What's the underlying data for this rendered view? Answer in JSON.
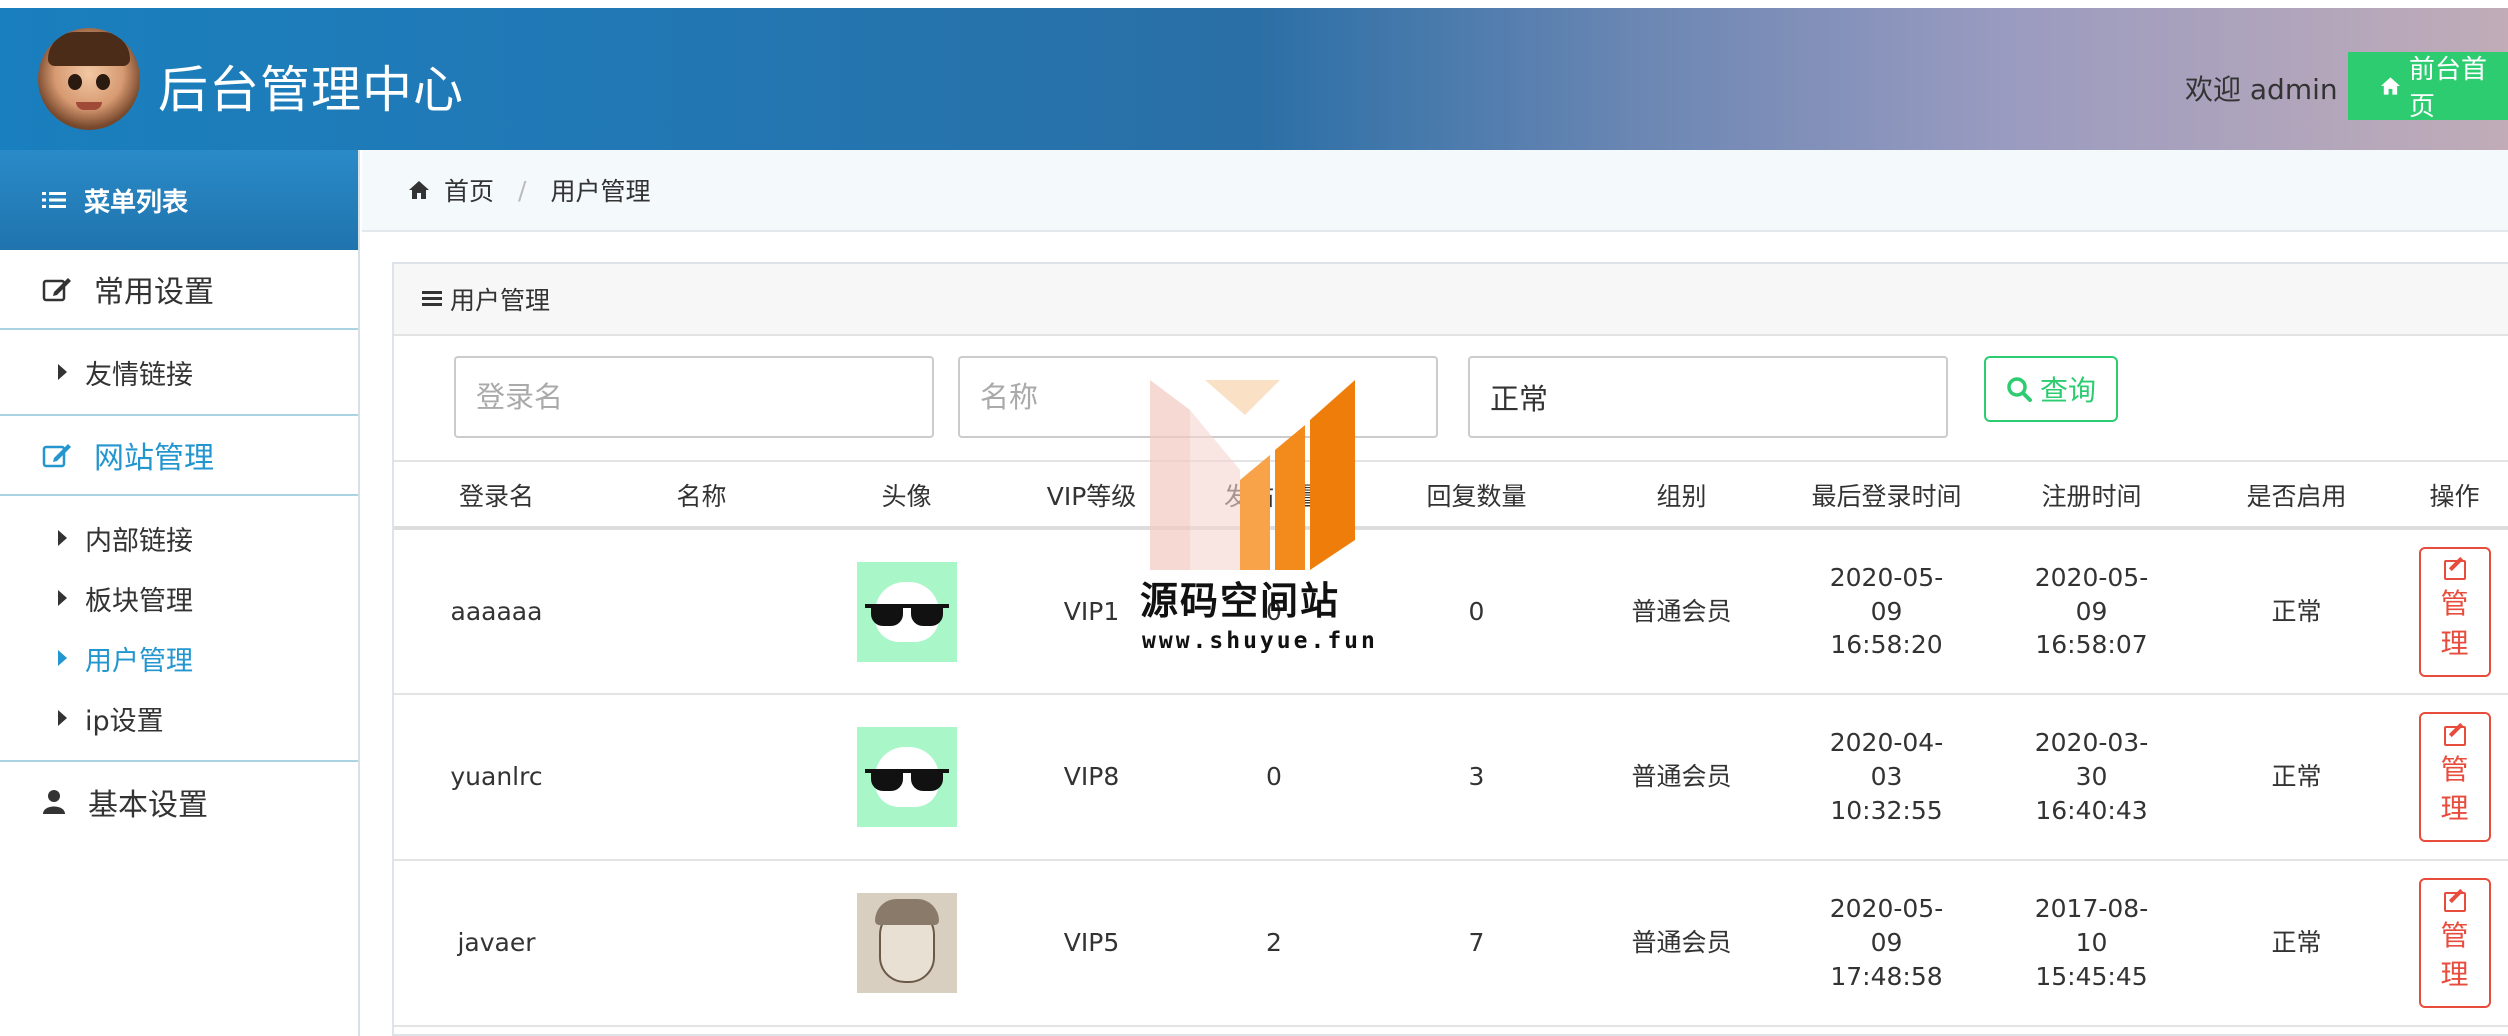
{
  "header": {
    "title": "后台管理中心",
    "welcome": "欢迎 admin",
    "front_button": "前台首页"
  },
  "sidebar": {
    "menu_title": "菜单列表",
    "groups": [
      {
        "label": "常用设置",
        "icon": "edit-icon",
        "items": [
          {
            "label": "友情链接"
          }
        ]
      },
      {
        "label": "网站管理",
        "icon": "edit-icon",
        "items": [
          {
            "label": "内部链接"
          },
          {
            "label": "板块管理"
          },
          {
            "label": "用户管理"
          },
          {
            "label": "ip设置"
          }
        ]
      },
      {
        "label": "基本设置",
        "icon": "user-icon",
        "items": []
      }
    ]
  },
  "breadcrumb": {
    "home": "首页",
    "current": "用户管理"
  },
  "panel": {
    "title": "用户管理"
  },
  "search": {
    "login_placeholder": "登录名",
    "name_placeholder": "名称",
    "status_value": "正常",
    "query_button": "查询"
  },
  "table": {
    "headers": [
      "登录名",
      "名称",
      "头像",
      "VIP等级",
      "发帖数量",
      "回复数量",
      "组别",
      "最后登录时间",
      "注册时间",
      "是否启用",
      "操作"
    ],
    "rows": [
      {
        "login": "aaaaaa",
        "name": "",
        "vip": "VIP1",
        "posts": "0",
        "replies": "0",
        "group": "普通会员",
        "last_login": "2020-05-09 16:58:20",
        "registered": "2020-05-09 16:58:07",
        "enabled": "正常",
        "action": "管理"
      },
      {
        "login": "yuanlrc",
        "name": "",
        "vip": "VIP8",
        "posts": "0",
        "replies": "3",
        "group": "普通会员",
        "last_login": "2020-04-03 10:32:55",
        "registered": "2020-03-30 16:40:43",
        "enabled": "正常",
        "action": "管理"
      },
      {
        "login": "javaer",
        "name": "",
        "vip": "VIP5",
        "posts": "2",
        "replies": "7",
        "group": "普通会员",
        "last_login": "2020-05-09 17:48:58",
        "registered": "2017-08-10 15:45:45",
        "enabled": "正常",
        "action": "管理"
      }
    ]
  },
  "watermark": {
    "text": "源码空间站",
    "url": "www.shuyue.fun"
  },
  "colors": {
    "accent_blue": "#2396d0",
    "green": "#2ecc71",
    "red": "#e74c3c",
    "header_start": "#1a7fbe"
  }
}
